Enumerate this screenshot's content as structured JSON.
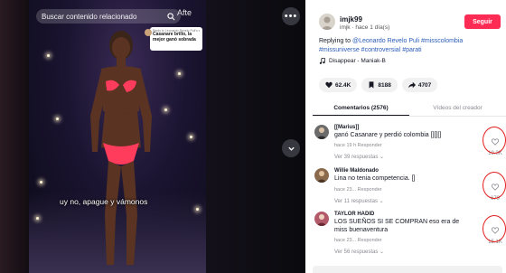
{
  "video": {
    "search_text": "Buscar contenido relacionado",
    "after_label": "Afte",
    "more_icon": "more-horizontal-icon",
    "caption": "uy no, apague y vámonos",
    "reply_card": {
      "line1": "Reply to Leonardo Revelo Puli's comment",
      "line2": "Casanare brillo, la mejor ganó sobrada"
    }
  },
  "author": {
    "username": "imjk99",
    "subtitle": "imjk · hace 1 día(s)",
    "follow_label": "Seguir"
  },
  "description": {
    "prefix": "Replying to ",
    "mention": "@Leonardo Revelo Puli",
    "tags": " #misscolombia #missuniverse #controversial #parati"
  },
  "music": {
    "icon": "music-note-icon",
    "title": "Disappear - Maniak-B"
  },
  "actions": [
    {
      "icon": "heart-icon",
      "count": "62.4K"
    },
    {
      "icon": "bookmark-icon",
      "count": "8188"
    },
    {
      "icon": "share-icon",
      "count": "4707"
    }
  ],
  "tabs": [
    {
      "label": "Comentarios (2576)",
      "active": true
    },
    {
      "label": "Vídeos del creador",
      "active": false
    }
  ],
  "comments": [
    {
      "user": "[[Marius]]",
      "text": "ganó Casanare y perdió colombia [][][]",
      "meta": "hace 19 h  Responder",
      "replies": "Ver 39 respuestas ⌄",
      "likes": "19.3K"
    },
    {
      "user": "Willie Maldonado",
      "text": "Lina no tenia competencia. []",
      "meta": "hace 23...  Responder",
      "replies": "Ver 11 respuestas ⌄",
      "likes": "679"
    },
    {
      "user": "TAYLOR HADID",
      "text": "LOS SUEÑOS SI SE COMPRAN eso era de miss buenaventura",
      "meta": "hace 23...  Responder",
      "replies": "Ver 56 respuestas ⌄",
      "likes": "15.1K"
    }
  ],
  "colors": {
    "accent": "#fe2c55",
    "link": "#2b5db9",
    "annotation": "#e0201e"
  }
}
